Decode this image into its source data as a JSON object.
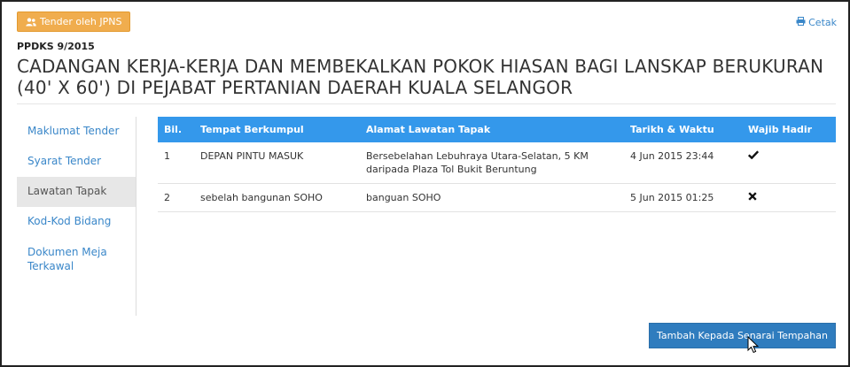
{
  "header": {
    "badge_label": "Tender oleh JPNS",
    "print_label": "Cetak",
    "reference": "PPDKS 9/2015",
    "title": "CADANGAN KERJA-KERJA DAN MEMBEKALKAN POKOK HIASAN BAGI LANSKAP BERUKURAN (40' X 60') DI PEJABAT PERTANIAN DAERAH KUALA SELANGOR"
  },
  "sidebar": {
    "items": [
      {
        "label": "Maklumat Tender",
        "active": false
      },
      {
        "label": "Syarat Tender",
        "active": false
      },
      {
        "label": "Lawatan Tapak",
        "active": true
      },
      {
        "label": "Kod-Kod Bidang",
        "active": false
      },
      {
        "label": "Dokumen Meja Terkawal",
        "active": false
      }
    ]
  },
  "table": {
    "columns": [
      "Bil.",
      "Tempat Berkumpul",
      "Alamat Lawatan Tapak",
      "Tarikh & Waktu",
      "Wajib Hadir"
    ],
    "rows": [
      {
        "no": "1",
        "place": "DEPAN PINTU MASUK",
        "address": "Bersebelahan Lebuhraya Utara-Selatan, 5 KM daripada Plaza Tol Bukit Beruntung",
        "datetime": "4 Jun 2015 23:44",
        "mandatory_icon": "check-icon"
      },
      {
        "no": "2",
        "place": "sebelah bangunan SOHO",
        "address": "banguan SOHO",
        "datetime": "5 Jun 2015 01:25",
        "mandatory_icon": "cross-icon"
      }
    ]
  },
  "actions": {
    "add_label": "Tambah Kepada Senarai Tempahan"
  },
  "colors": {
    "badge": "#f0ad4e",
    "table_header": "#3498eb",
    "primary_button": "#2f7cbe",
    "link": "#3a87c9"
  }
}
